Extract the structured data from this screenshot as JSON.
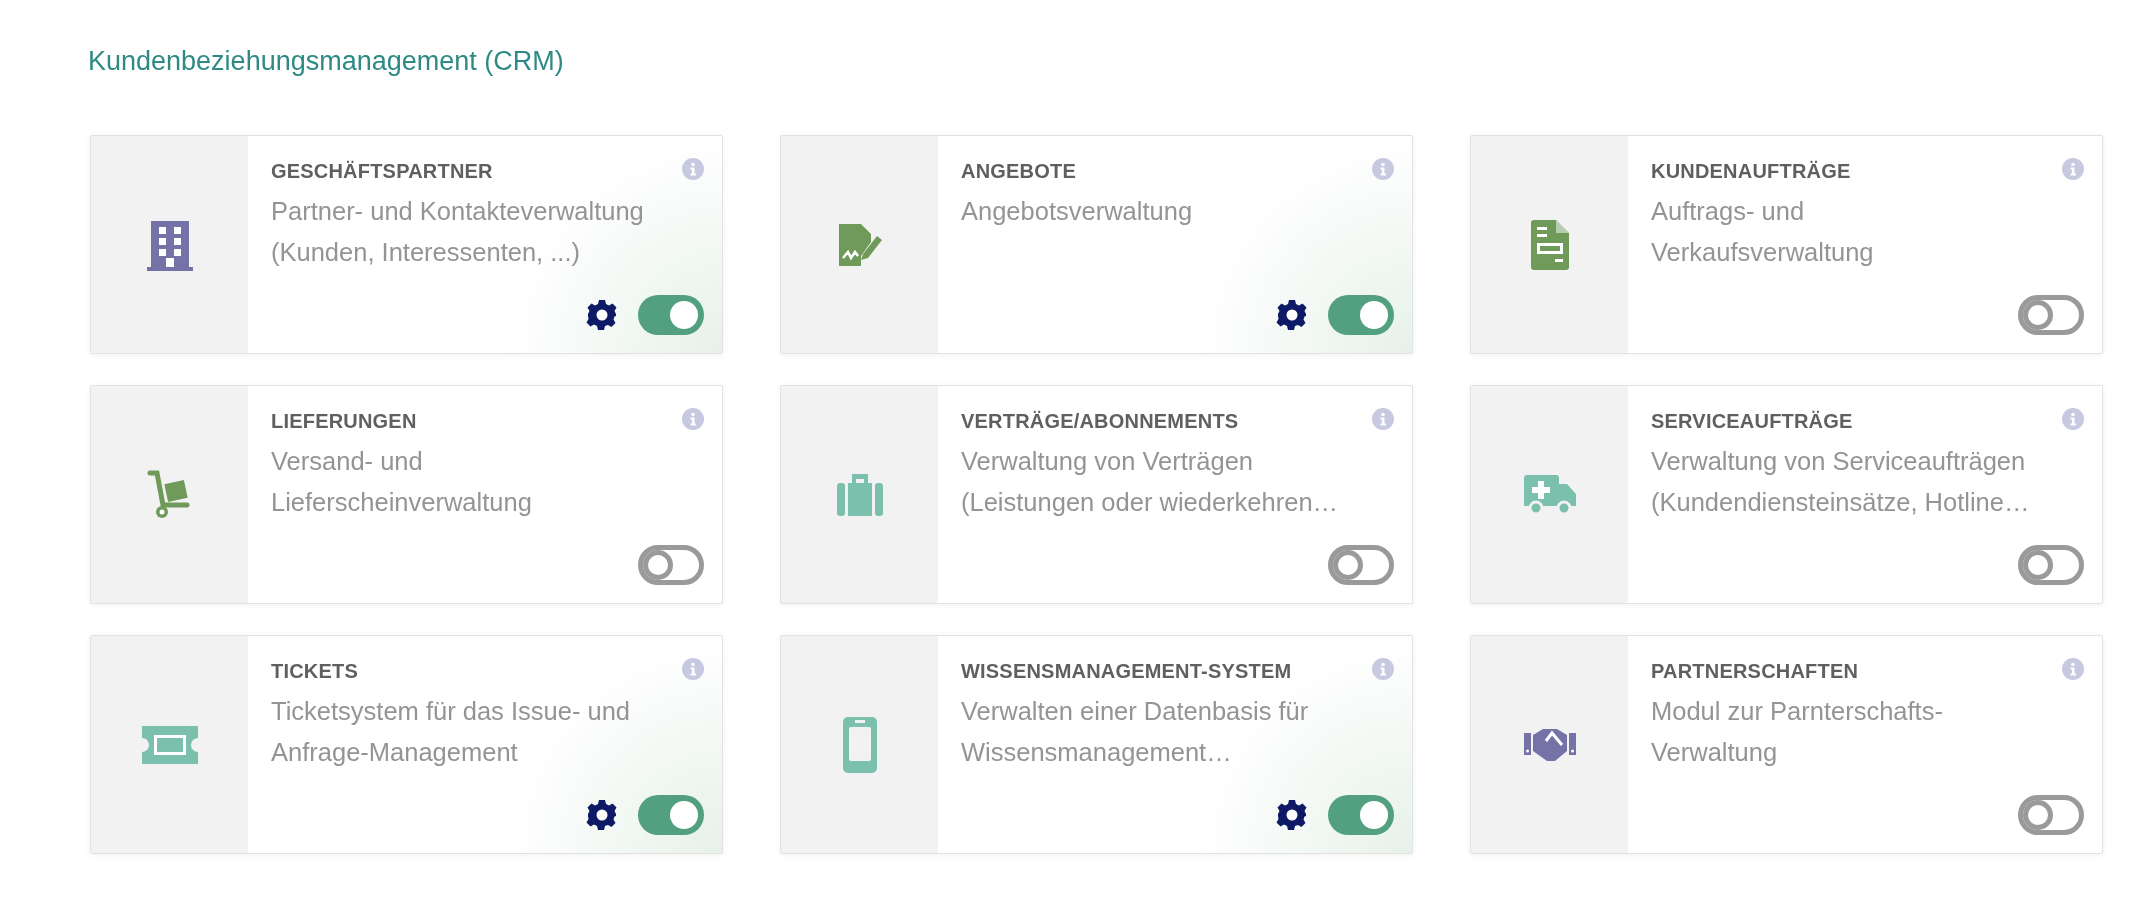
{
  "heading": "Kundenbeziehungsmanagement (CRM)",
  "modules": [
    {
      "title": "GESCHÄFTSPARTNER",
      "description": [
        "Partner- und Kontakteverwaltung",
        "(Kunden, Interessenten, ...)"
      ],
      "color": "#7472a6",
      "enabled": true
    },
    {
      "title": "ANGEBOTE",
      "description": [
        "Angebotsverwaltung"
      ],
      "color": "#6f9a5a",
      "enabled": true
    },
    {
      "title": "KUNDENAUFTRÄGE",
      "description": [
        "Auftrags- und",
        "Verkaufsverwaltung"
      ],
      "color": "#6f9a5a",
      "enabled": false
    },
    {
      "title": "LIEFERUNGEN",
      "description": [
        "Versand- und",
        "Lieferscheinverwaltung"
      ],
      "color": "#6f9a5a",
      "enabled": false
    },
    {
      "title": "VERTRÄGE/ABONNEMENTS",
      "description": [
        "Verwaltung von Verträgen",
        "(Leistungen oder wiederkehren…"
      ],
      "color": "#7bbfad",
      "enabled": false
    },
    {
      "title": "SERVICEAUFTRÄGE",
      "description": [
        "Verwaltung von Serviceaufträgen",
        "(Kundendiensteinsätze, Hotline…"
      ],
      "color": "#7bbfad",
      "enabled": false
    },
    {
      "title": "TICKETS",
      "description": [
        "Ticketsystem für das Issue- und",
        "Anfrage-Management"
      ],
      "color": "#7bbfad",
      "enabled": true
    },
    {
      "title": "WISSENSMANAGEMENT-SYSTEM",
      "description": [
        "Verwalten einer Datenbasis für",
        "Wissensmanagement…"
      ],
      "color": "#7bbfad",
      "enabled": true
    },
    {
      "title": "PARTNERSCHAFTEN",
      "description": [
        "Modul zur Parnterschafts-",
        "Verwaltung"
      ],
      "color": "#7472a6",
      "enabled": false
    }
  ]
}
